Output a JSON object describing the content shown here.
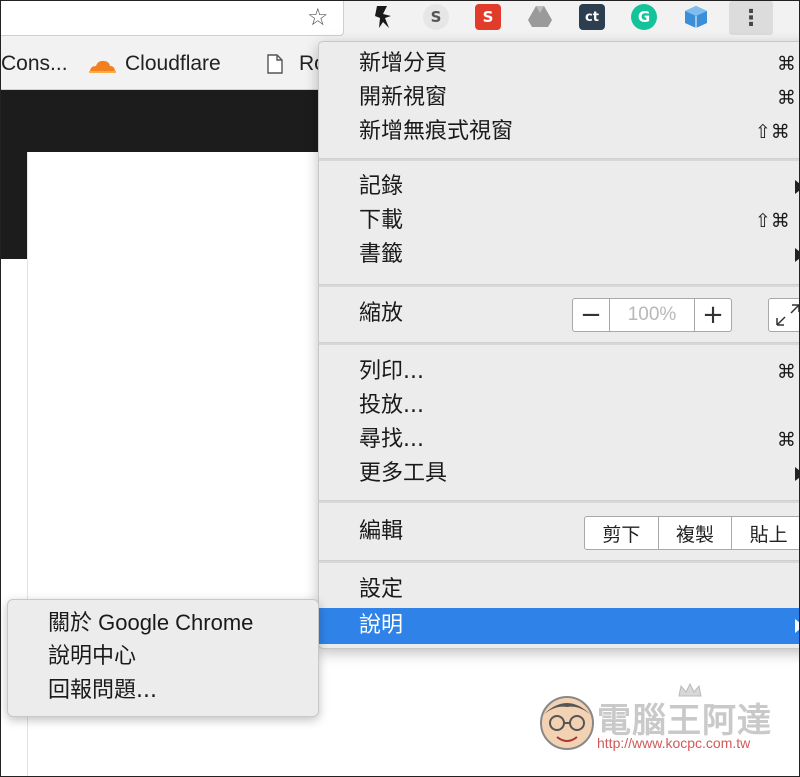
{
  "bookmarks": {
    "item1": "Cons...",
    "item2": "Cloudflare",
    "item3": "Ro"
  },
  "extensions": [
    {
      "icon": "ninja-extension-icon",
      "glyph": "",
      "color": "#1a1a1a"
    },
    {
      "icon": "s-extension-icon",
      "glyph": "S",
      "color": "#e6e6e6"
    },
    {
      "icon": "s-red-extension-icon",
      "glyph": "S",
      "color": "#e13b2b"
    },
    {
      "icon": "drive-extension-icon",
      "glyph": "",
      "color": "#9a9a9a"
    },
    {
      "icon": "ct-extension-icon",
      "glyph": "ct",
      "color": "#2c3e50"
    },
    {
      "icon": "grammarly-extension-icon",
      "glyph": "G",
      "color": "#15c39a"
    },
    {
      "icon": "cube-extension-icon",
      "glyph": "",
      "color": "#3b8ed8"
    }
  ],
  "menu": {
    "new_tab": "新增分頁",
    "new_tab_sc": "⌘",
    "new_window": "開新視窗",
    "new_window_sc": "⌘",
    "incognito": "新增無痕式視窗",
    "incognito_sc": "⇧⌘",
    "history": "記錄",
    "downloads": "下載",
    "downloads_sc": "⇧⌘",
    "bookmarks": "書籤",
    "zoom": "縮放",
    "zoom_minus": "−",
    "zoom_value": "100%",
    "zoom_plus": "+",
    "print": "列印...",
    "print_sc": "⌘",
    "cast": "投放...",
    "find": "尋找...",
    "find_sc": "⌘",
    "more_tools": "更多工具",
    "edit": "編輯",
    "cut": "剪下",
    "copy": "複製",
    "paste": "貼上",
    "settings": "設定",
    "help": "說明"
  },
  "help_submenu": {
    "about": "關於 Google Chrome",
    "help_center": "說明中心",
    "report": "回報問題..."
  },
  "watermark": {
    "name": "電腦王阿達",
    "url": "http://www.kocpc.com.tw"
  },
  "colors": {
    "highlight": "#2f83e8",
    "menu_bg": "#ececec"
  }
}
